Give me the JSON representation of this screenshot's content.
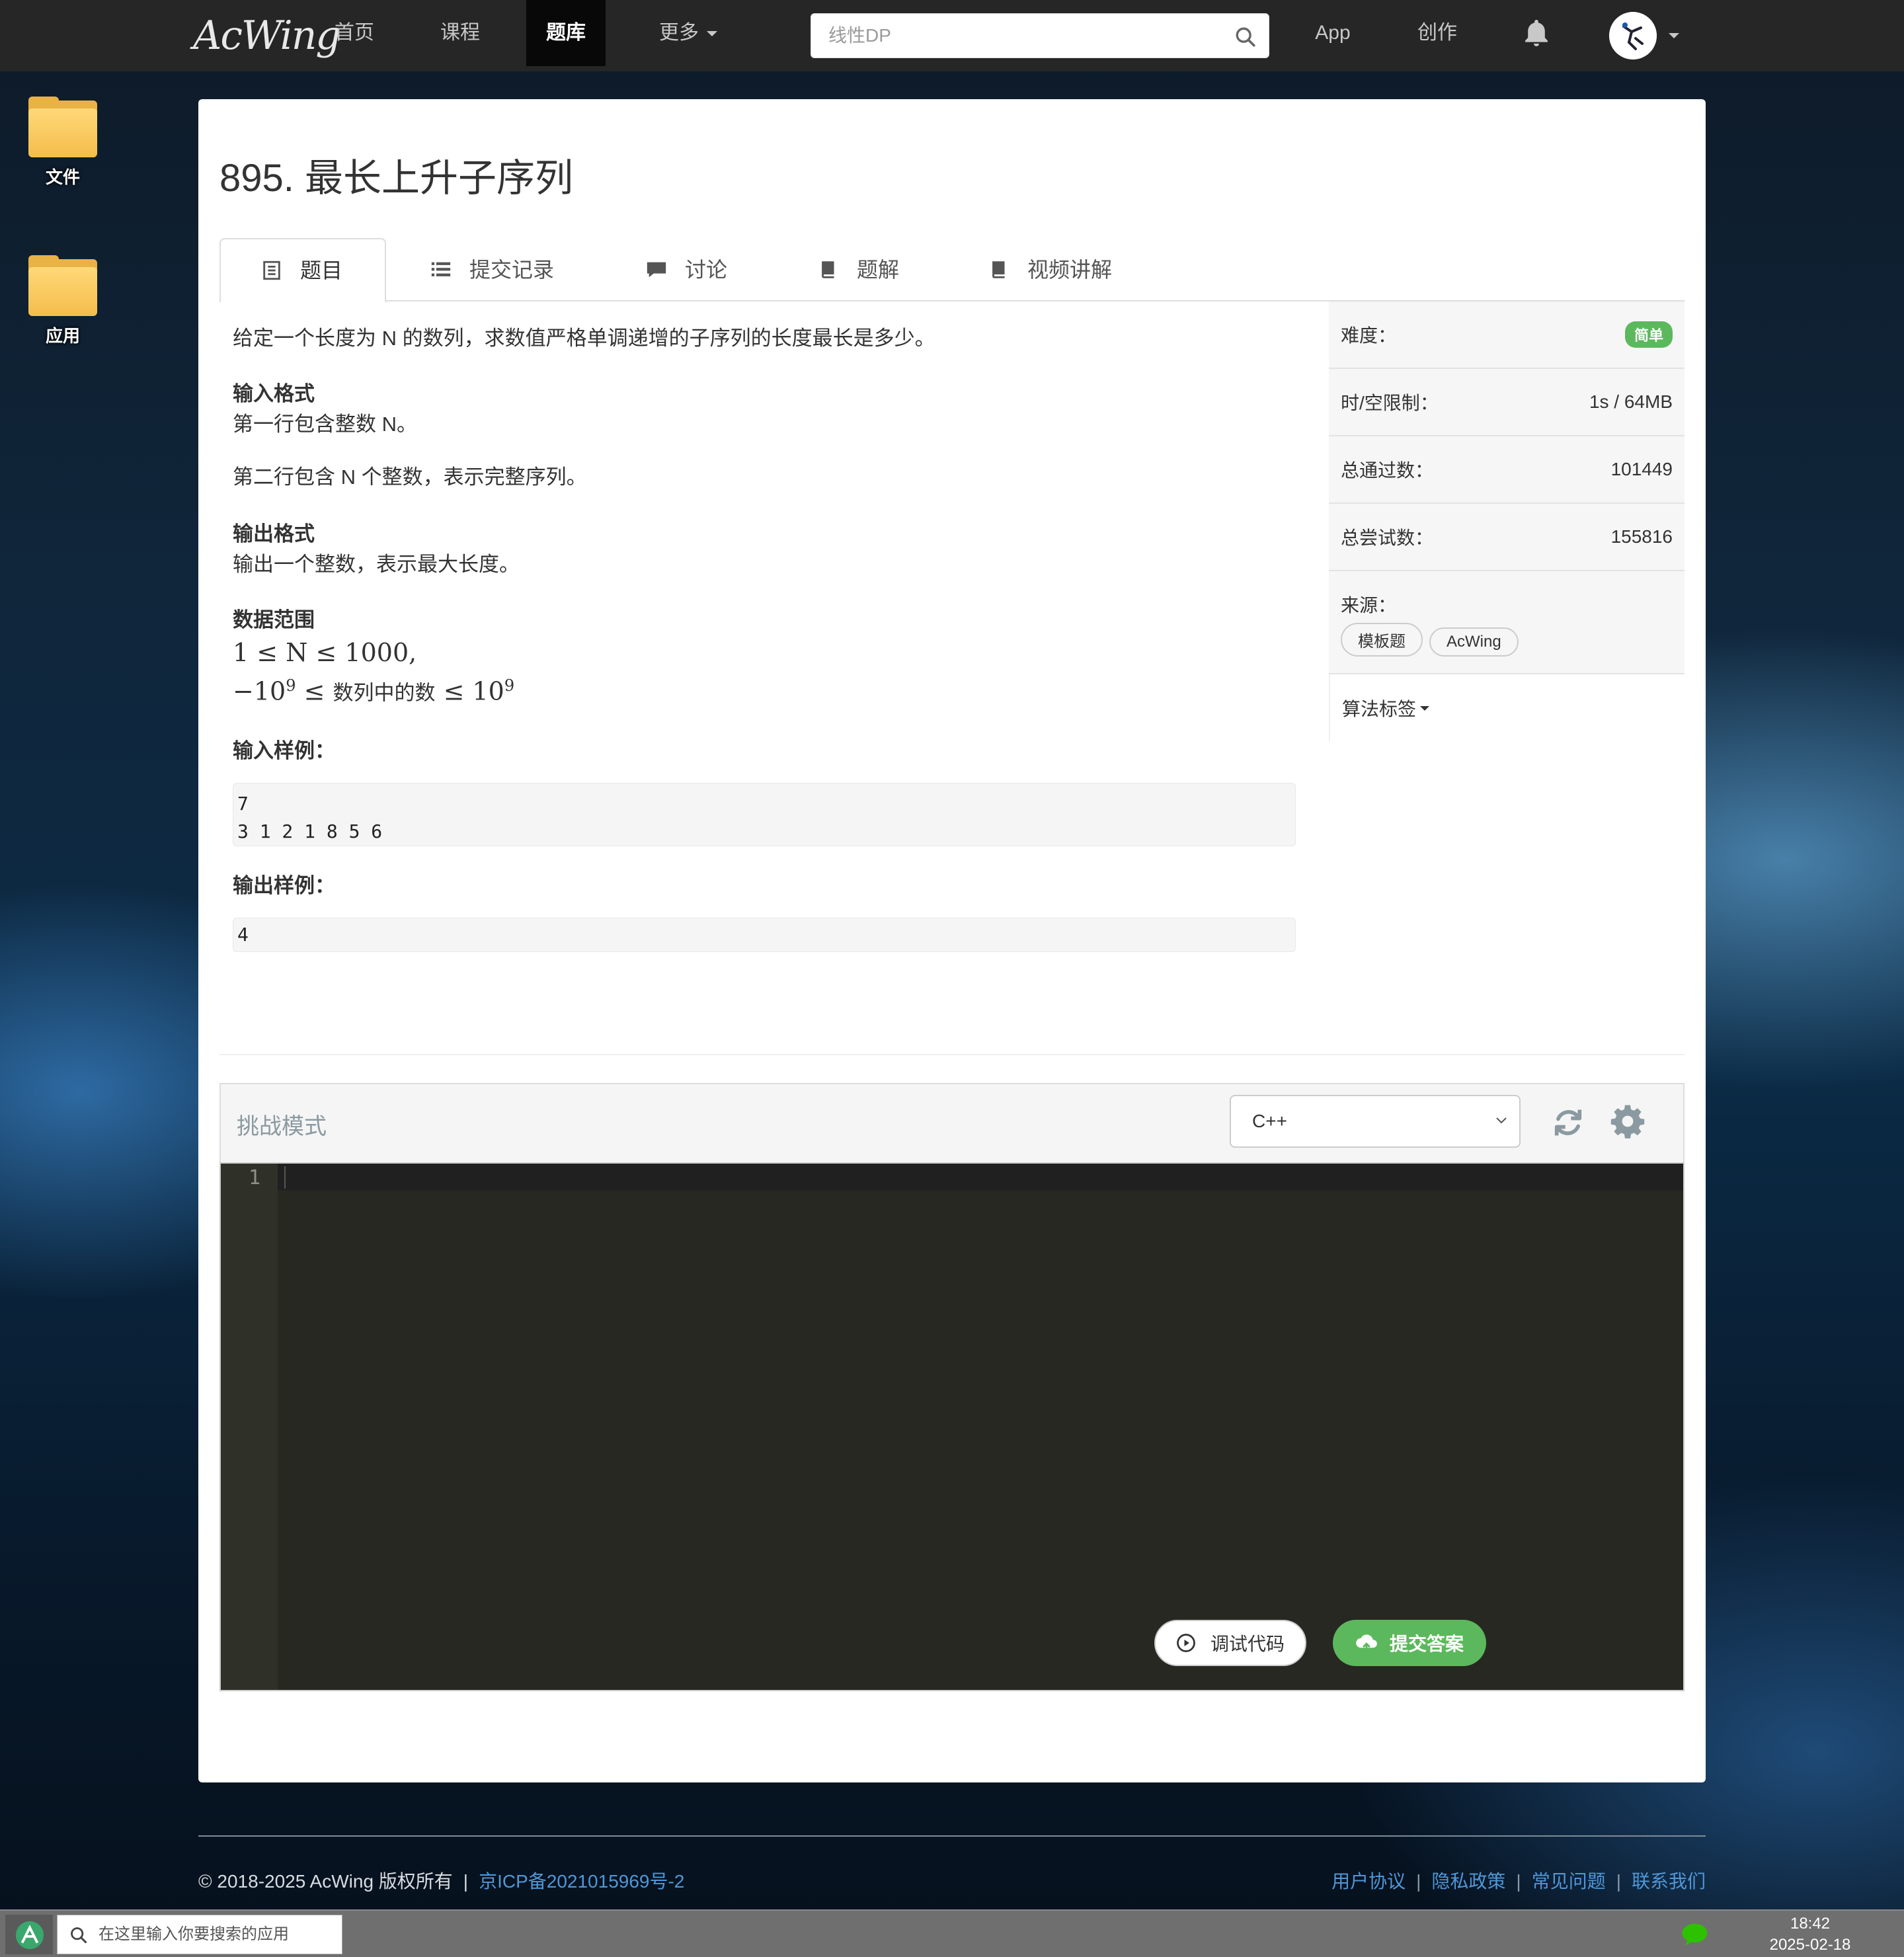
{
  "nav": {
    "logo": "AcWing",
    "items": [
      "首页",
      "课程",
      "题库",
      "更多"
    ],
    "active_index": 2,
    "search_placeholder": "线性DP",
    "app": "App",
    "create": "创作"
  },
  "desktop": {
    "icons": [
      "文件",
      "应用"
    ]
  },
  "problem": {
    "title": "895. 最长上升子序列",
    "tabs": [
      "题目",
      "提交记录",
      "讨论",
      "题解",
      "视频讲解"
    ],
    "description": "给定一个长度为 N 的数列，求数值严格单调递增的子序列的长度最长是多少。",
    "input_format_title": "输入格式",
    "input_format_lines": [
      "第一行包含整数 N。",
      "第二行包含 N 个整数，表示完整序列。"
    ],
    "output_format_title": "输出格式",
    "output_format_text": "输出一个整数，表示最大长度。",
    "range_title": "数据范围",
    "range_line1": "1 ≤ N ≤ 1000,",
    "range_line2_prefix": "−10",
    "range_line2_exp": "9",
    "range_line2_mid": " ≤ ",
    "range_line2_zh": "数列中的数",
    "range_line2_suffix": " ≤ 10",
    "range_line2_exp2": "9",
    "sample_input_title": "输入样例：",
    "sample_input": "7\n3 1 2 1 8 5 6",
    "sample_output_title": "输出样例：",
    "sample_output": "4"
  },
  "info": {
    "difficulty_label": "难度：",
    "difficulty_value": "简单",
    "limit_label": "时/空限制：",
    "limit_value": "1s / 64MB",
    "passed_label": "总通过数：",
    "passed_value": "101449",
    "tried_label": "总尝试数：",
    "tried_value": "155816",
    "source_label": "来源：",
    "source_tags": [
      "模板题",
      "AcWing"
    ],
    "algo_label": "算法标签"
  },
  "editor": {
    "mode": "挑战模式",
    "language": "C++",
    "line_number": "1",
    "debug_button": "调试代码",
    "submit_button": "提交答案"
  },
  "footer": {
    "copyright": "© 2018-2025 AcWing 版权所有",
    "separator": "|",
    "icp": "京ICP备2021015969号-2",
    "links": [
      "用户协议",
      "隐私政策",
      "常见问题",
      "联系我们"
    ]
  },
  "taskbar": {
    "search_placeholder": "在这里输入你要搜索的应用",
    "time": "18:42",
    "date": "2025-02-18"
  },
  "colors": {
    "nav_bg": "#262626",
    "success_green": "#5cb85c",
    "link_blue": "#4f97d8",
    "editor_bg": "#272822"
  }
}
